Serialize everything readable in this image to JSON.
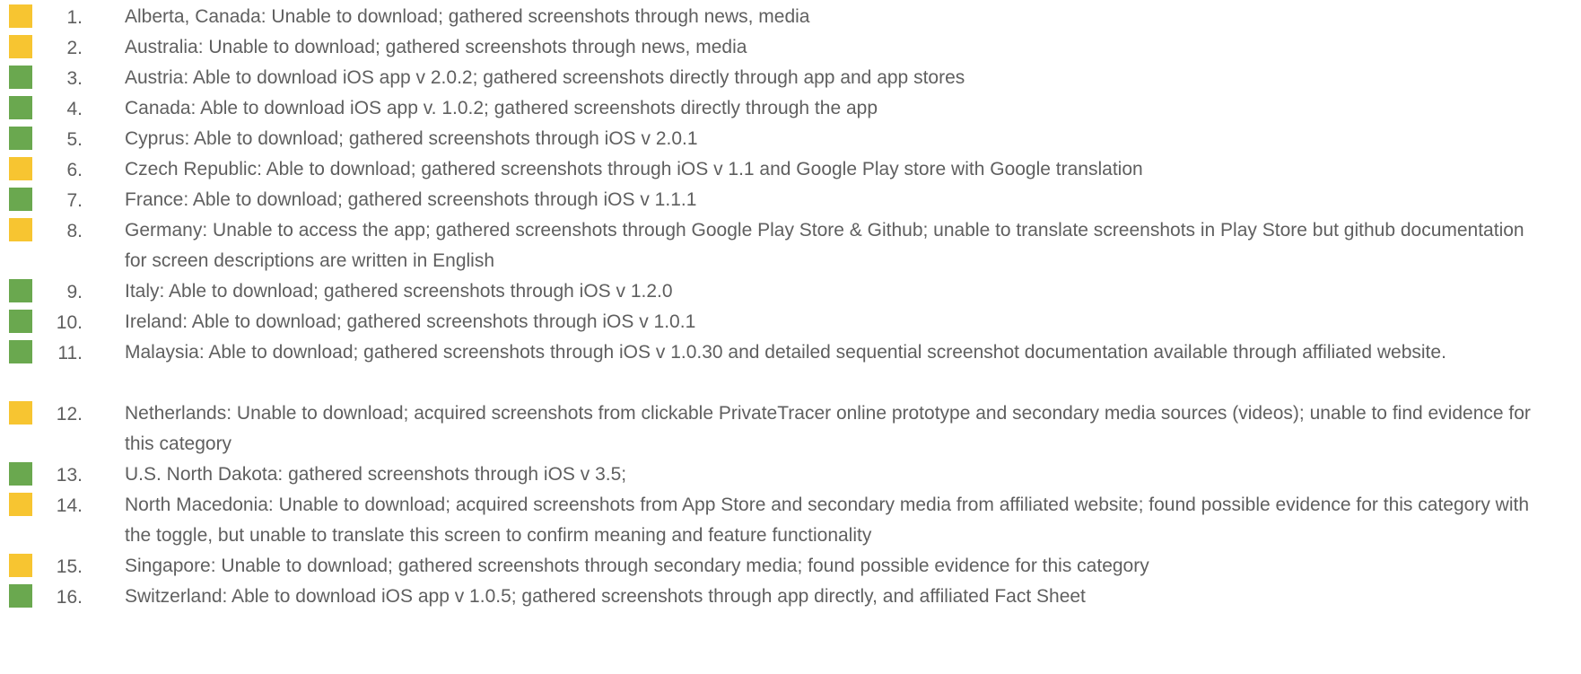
{
  "colors": {
    "yellow": "#f7c531",
    "green": "#6aa84f"
  },
  "items": [
    {
      "num": "1.",
      "status": "yellow",
      "text": "Alberta, Canada: Unable to download; gathered screenshots through news, media"
    },
    {
      "num": "2.",
      "status": "yellow",
      "text": "Australia: Unable to download; gathered screenshots through news, media"
    },
    {
      "num": "3.",
      "status": "green",
      "text": "Austria: Able to download iOS app v 2.0.2; gathered screenshots directly through app and app stores"
    },
    {
      "num": "4.",
      "status": "green",
      "text": "Canada: Able to download iOS app v. 1.0.2; gathered screenshots directly through the app"
    },
    {
      "num": "5.",
      "status": "green",
      "text": "Cyprus: Able to download; gathered screenshots through iOS v 2.0.1"
    },
    {
      "num": "6.",
      "status": "yellow",
      "text": "Czech Republic: Able to download; gathered screenshots through iOS v 1.1 and Google Play store with Google translation"
    },
    {
      "num": "7.",
      "status": "green",
      "text": "France: Able to download; gathered screenshots through iOS v 1.1.1"
    },
    {
      "num": "8.",
      "status": "yellow",
      "text": "Germany: Unable to access the app; gathered screenshots through Google Play Store & Github; unable to translate screenshots in Play Store but github documentation for screen descriptions are written in English"
    },
    {
      "num": "9.",
      "status": "green",
      "text": "Italy: Able to download; gathered screenshots through iOS v 1.2.0"
    },
    {
      "num": "10.",
      "status": "green",
      "text": "Ireland: Able to download; gathered screenshots through iOS v 1.0.1"
    },
    {
      "num": "11.",
      "status": "green",
      "text": "Malaysia: Able to download; gathered screenshots through iOS v 1.0.30 and detailed sequential screenshot documentation available through affiliated website."
    },
    {
      "num": "12.",
      "status": "yellow",
      "text": "Netherlands: Unable to download; acquired screenshots from clickable PrivateTracer online prototype and secondary media sources (videos); unable to find evidence for this category"
    },
    {
      "num": "13.",
      "status": "green",
      "text": "U.S. North Dakota: gathered screenshots through iOS v 3.5;"
    },
    {
      "num": "14.",
      "status": "yellow",
      "text": "North Macedonia: Unable to download; acquired screenshots from App Store and secondary media from affiliated website; found possible evidence for this category with the toggle, but unable to translate this screen to confirm meaning and feature functionality"
    },
    {
      "num": "15.",
      "status": "yellow",
      "text": "Singapore: Unable to download; gathered screenshots through secondary media; found possible evidence for this category"
    },
    {
      "num": "16.",
      "status": "green",
      "text": "Switzerland: Able to download iOS app v 1.0.5; gathered screenshots through app directly, and affiliated Fact Sheet"
    }
  ]
}
